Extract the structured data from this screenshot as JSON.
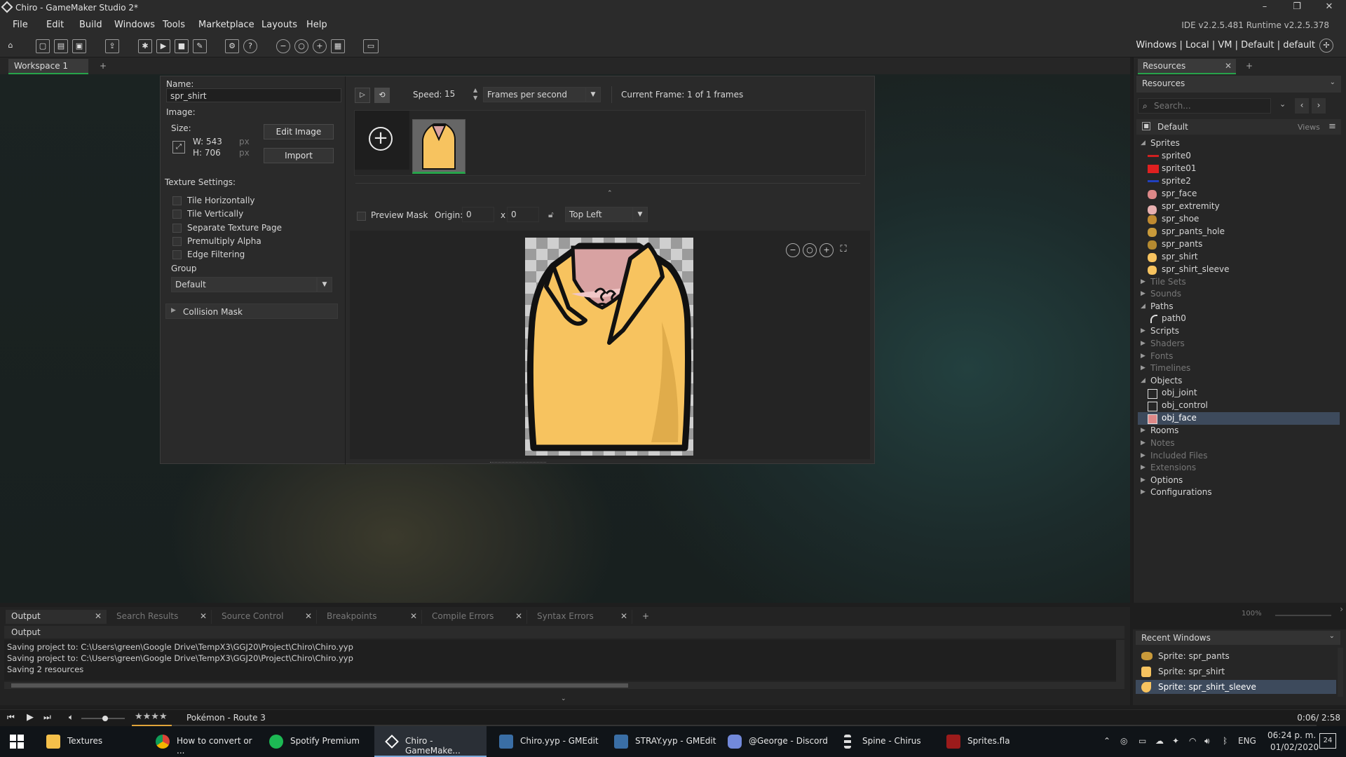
{
  "window": {
    "title": "Chiro - GameMaker Studio 2*",
    "minimize": "–",
    "maximize": "❐",
    "close": "✕"
  },
  "menu": {
    "items": [
      "File",
      "Edit",
      "Build",
      "Windows",
      "Tools",
      "Marketplace",
      "Layouts",
      "Help"
    ],
    "version": "IDE v2.2.5.481  Runtime v2.2.5.378"
  },
  "toolbar": {
    "right_text": "Windows  |  Local  |  VM  |  Default  |  default"
  },
  "workspace_tabs": {
    "active": "Workspace 1",
    "add": "+"
  },
  "editor": {
    "name_label": "Name:",
    "name_value": "spr_shirt",
    "image_label": "Image:",
    "size_label": "Size:",
    "width": "W: 543",
    "height": "H: 706",
    "px": "px",
    "edit_image": "Edit Image",
    "import": "Import",
    "texture_label": "Texture Settings:",
    "texture_options": [
      "Tile Horizontally",
      "Tile Vertically",
      "Separate Texture Page",
      "Premultiply Alpha",
      "Edge Filtering"
    ],
    "group_label": "Group",
    "group_value": "Default",
    "collision_mask": "Collision Mask",
    "speed_label": "Speed:",
    "speed_value": "15",
    "speed_unit": "Frames per second",
    "current_frame": "Current Frame: 1 of 1 frames",
    "preview_mask": "Preview Mask",
    "origin_label": "Origin:",
    "origin_x": "0",
    "origin_sep": "x",
    "origin_y": "0",
    "origin_preset": "Top Left"
  },
  "resources": {
    "tab": "Resources",
    "header": "Resources",
    "search_placeholder": "Search...",
    "group": "Default",
    "views": "Views",
    "zoom": "100%",
    "categories": [
      {
        "name": "Sprites",
        "open": true,
        "items": [
          "sprite0",
          "sprite01",
          "sprite2",
          "spr_face",
          "spr_extremity",
          "spr_shoe",
          "spr_pants_hole",
          "spr_pants",
          "spr_shirt",
          "spr_shirt_sleeve"
        ]
      },
      {
        "name": "Tile Sets",
        "open": false,
        "dim": true
      },
      {
        "name": "Sounds",
        "open": false,
        "dim": true
      },
      {
        "name": "Paths",
        "open": true,
        "items": [
          "path0"
        ]
      },
      {
        "name": "Scripts",
        "open": false,
        "dim": false
      },
      {
        "name": "Shaders",
        "open": false,
        "dim": true
      },
      {
        "name": "Fonts",
        "open": false,
        "dim": true
      },
      {
        "name": "Timelines",
        "open": false,
        "dim": true
      },
      {
        "name": "Objects",
        "open": true,
        "items": [
          "obj_joint",
          "obj_control",
          "obj_face"
        ]
      },
      {
        "name": "Rooms",
        "open": false,
        "dim": false
      },
      {
        "name": "Notes",
        "open": false,
        "dim": true
      },
      {
        "name": "Included Files",
        "open": false,
        "dim": true
      },
      {
        "name": "Extensions",
        "open": false,
        "dim": true
      },
      {
        "name": "Options",
        "open": false,
        "dim": false
      },
      {
        "name": "Configurations",
        "open": false,
        "dim": false
      }
    ]
  },
  "output": {
    "tabs": [
      "Output",
      "Search Results",
      "Source Control",
      "Breakpoints",
      "Compile Errors",
      "Syntax Errors"
    ],
    "add": "+",
    "header": "Output",
    "lines": [
      "Saving project to: C:\\Users\\green\\Google Drive\\TempX3\\GGJ20\\Project\\Chiro\\Chiro.yyp",
      "Saving project to: C:\\Users\\green\\Google Drive\\TempX3\\GGJ20\\Project\\Chiro\\Chiro.yyp",
      "Saving 2 resources"
    ]
  },
  "recent": {
    "header": "Recent Windows",
    "items": [
      "Sprite: spr_pants",
      "Sprite: spr_shirt",
      "Sprite: spr_shirt_sleeve"
    ]
  },
  "media": {
    "stars": "★★★★",
    "track": "Pokémon - Route 3",
    "time": "0:06/ 2:58",
    "progress": 0.034
  },
  "taskbar": {
    "items": [
      "Textures",
      "How to convert or ...",
      "Spotify Premium",
      "Chiro - GameMake...",
      "Chiro.yyp - GMEdit",
      "STRAY.yyp - GMEdit",
      "@George - Discord",
      "Spine - Chirus",
      "Sprites.fla"
    ],
    "lang": "ENG",
    "time": "06:24 p. m.",
    "date": "01/02/2020",
    "notif": "24"
  },
  "colors": {
    "accent_green": "#27a34a",
    "shirt": "#f7c35f",
    "selected": "#3d4a5c"
  }
}
